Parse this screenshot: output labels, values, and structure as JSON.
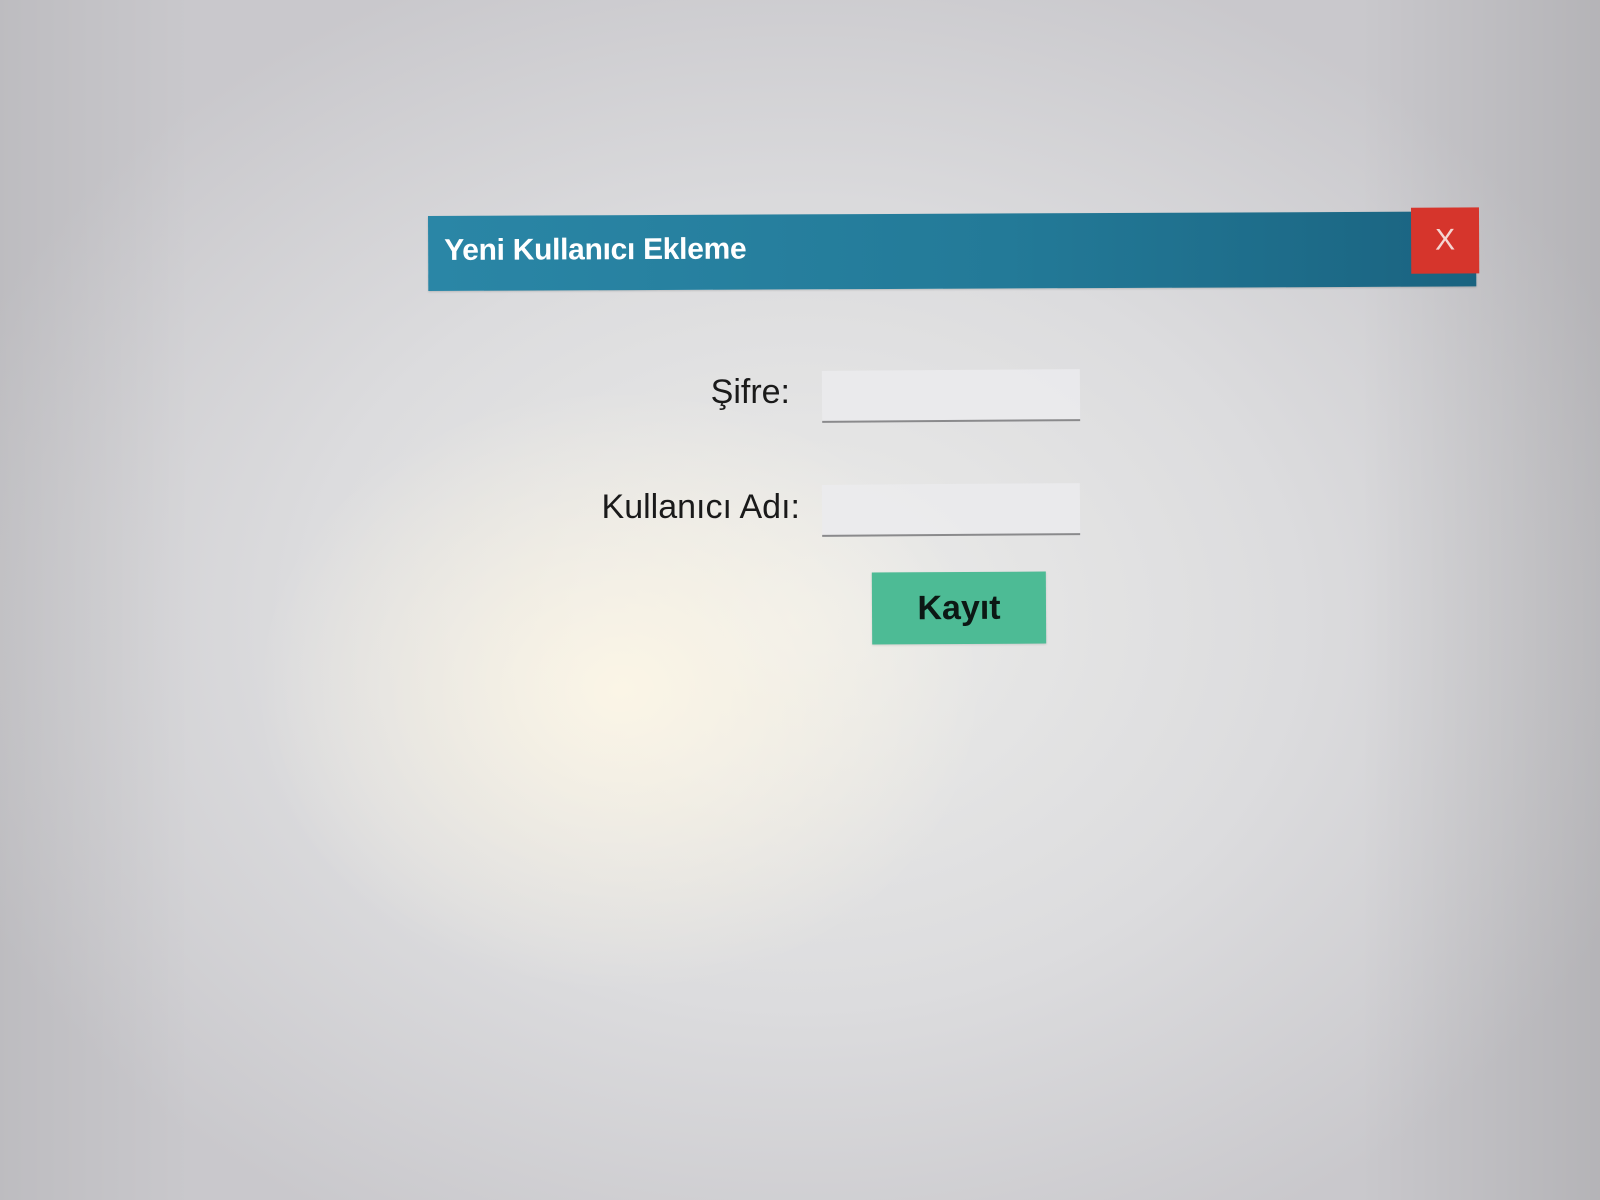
{
  "dialog": {
    "title": "Yeni Kullanıcı Ekleme",
    "close_label": "X",
    "close_icon": "close-icon"
  },
  "form": {
    "password_label": "Şifre:",
    "password_value": "",
    "username_label": "Kullanıcı Adı:",
    "username_value": "",
    "save_label": "Kayıt"
  },
  "colors": {
    "titlebar": "#237a98",
    "close_button": "#d6352c",
    "save_button": "#4dbb95"
  }
}
